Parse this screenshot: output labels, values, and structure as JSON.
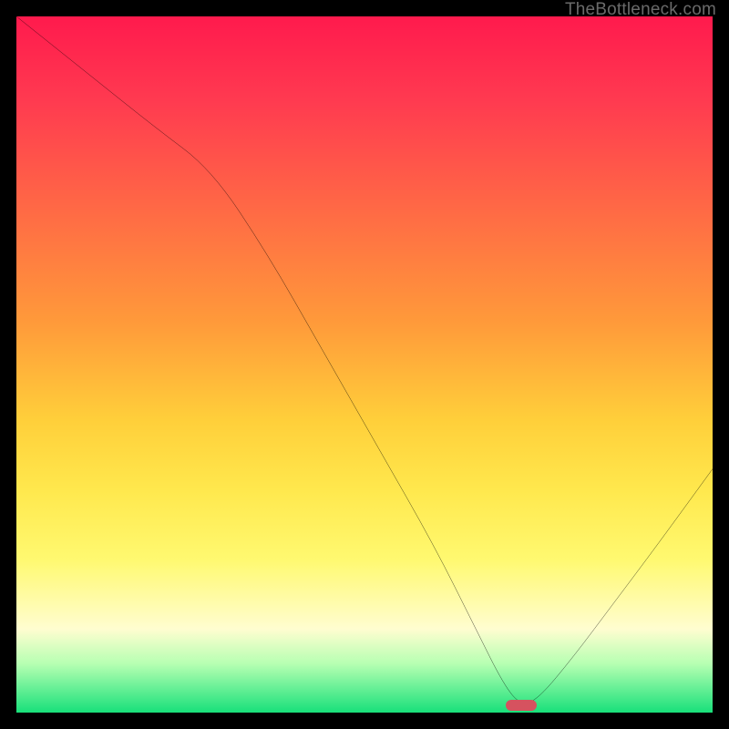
{
  "attribution": "TheBottleneck.com",
  "marker": {
    "color": "#d6525f",
    "x_pct": 72.5,
    "y_pct": 99.0
  },
  "chart_data": {
    "type": "line",
    "title": "",
    "xlabel": "",
    "ylabel": "",
    "xlim": [
      0,
      100
    ],
    "ylim": [
      0,
      100
    ],
    "grid": false,
    "legend": false,
    "note": "x and y are percentages of the plot area; curve is a single series showing bottleneck % vs a swept parameter, minimum near x≈72.5",
    "series": [
      {
        "name": "bottleneck-curve",
        "x": [
          0,
          10,
          20,
          28,
          36,
          44,
          52,
          60,
          66,
          70,
          72.5,
          75,
          80,
          86,
          92,
          100
        ],
        "y": [
          100,
          92,
          84,
          78,
          66,
          52,
          38,
          24,
          12,
          4,
          1,
          2,
          8,
          16,
          24,
          35
        ]
      }
    ],
    "marker_point": {
      "x": 72.5,
      "y": 1
    },
    "background_gradient": {
      "top": "#ff1a4d",
      "mid": "#ffe84d",
      "bottom": "#18e07a"
    }
  }
}
